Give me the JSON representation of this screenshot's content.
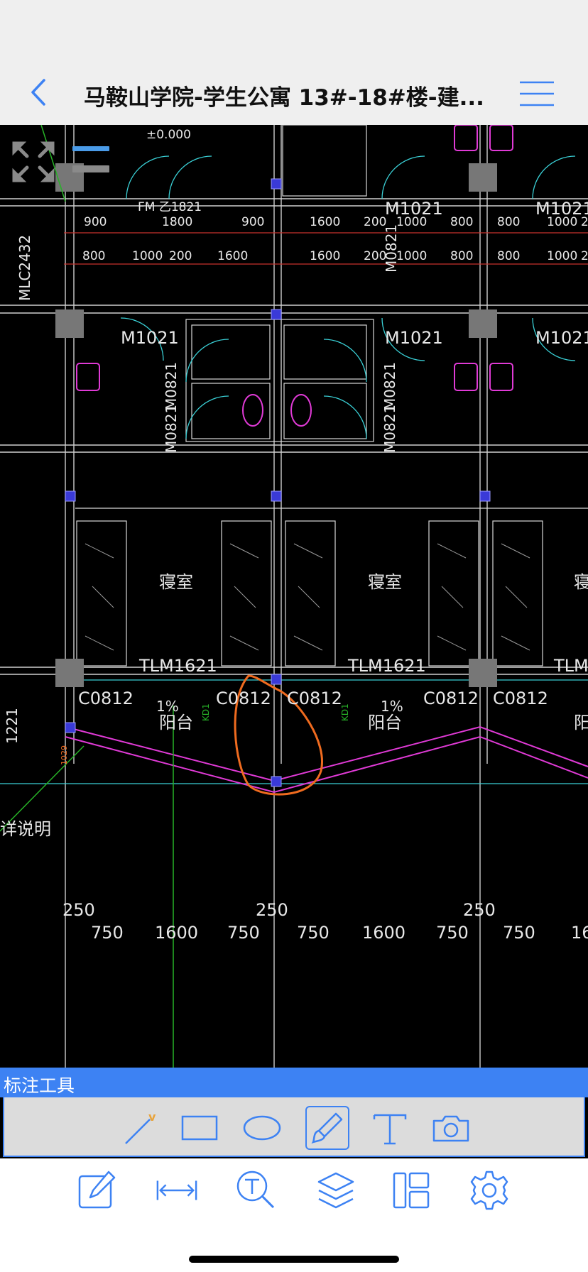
{
  "header": {
    "title": "马鞍山学院-学生公寓 13#-18#楼-建...",
    "back_icon": "chevron-left-icon",
    "menu_icon": "hamburger-menu-icon"
  },
  "drawing": {
    "elevation": "±0.000",
    "fire_door": "FM 乙1821",
    "window_vertical": "MLC2432",
    "door_m1021": "M1021",
    "door_m0821": "M0821",
    "room": "寝室",
    "sliding_door": "TLM1621",
    "window_c0812": "C0812",
    "balcony": "阳台",
    "slope": "1%",
    "kd_label": "KD1",
    "dim_1221": "1221",
    "dim_1029": "1029",
    "note": "详说明",
    "dims_row1": [
      "900",
      "1800",
      "900",
      "1600",
      "200",
      "1000",
      "800",
      "800",
      "1000",
      "2"
    ],
    "dims_row2": [
      "800",
      "1000",
      "200",
      "1600",
      "1600",
      "200",
      "1000",
      "800",
      "800",
      "1000",
      "2"
    ],
    "dims_bottom1": [
      "250",
      "250",
      "250"
    ],
    "dims_bottom2": [
      "750",
      "1600",
      "750",
      "750",
      "1600",
      "750",
      "750",
      "16"
    ]
  },
  "annotation_panel": {
    "title": "标注工具",
    "tools": [
      {
        "name": "line-tool",
        "icon": "line-icon"
      },
      {
        "name": "rectangle-tool",
        "icon": "rectangle-icon"
      },
      {
        "name": "ellipse-tool",
        "icon": "ellipse-icon"
      },
      {
        "name": "freehand-tool",
        "icon": "brush-icon",
        "active": true
      },
      {
        "name": "text-tool",
        "icon": "text-icon"
      },
      {
        "name": "camera-tool",
        "icon": "camera-icon"
      }
    ]
  },
  "toolbar": {
    "tools": [
      "edit-icon",
      "measure-icon",
      "text-search-icon",
      "layers-icon",
      "layout-icon",
      "settings-icon"
    ]
  },
  "colors": {
    "accent": "#3d82f3",
    "cad_background": "#000000",
    "markup": "#ef6b1f"
  }
}
